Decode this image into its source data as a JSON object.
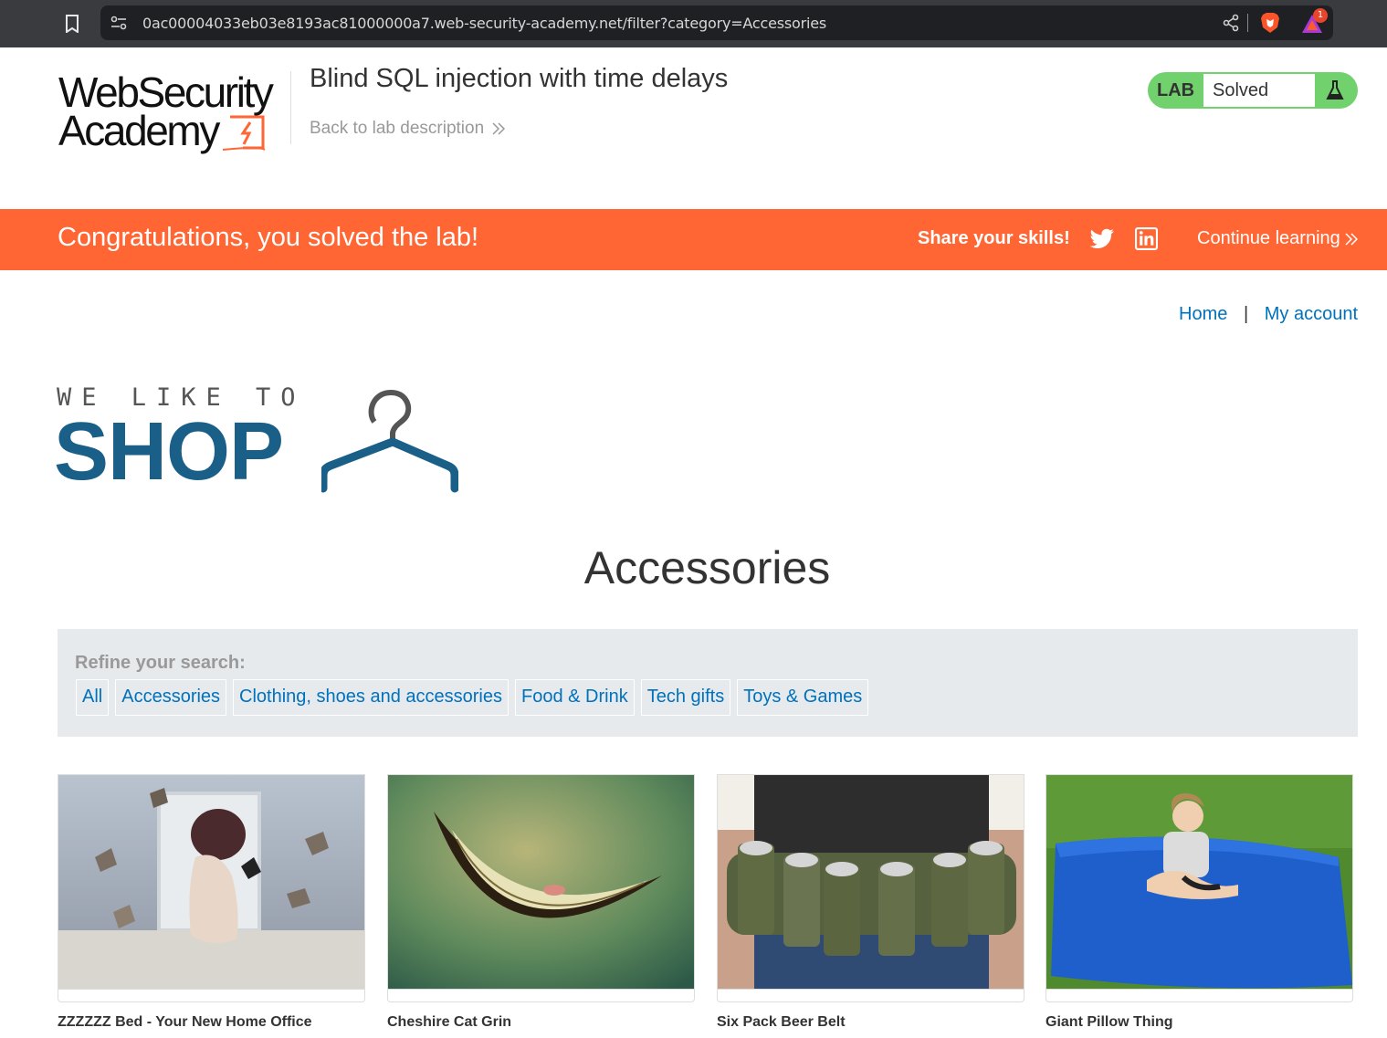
{
  "browser": {
    "url": "0ac00004033eb03e8193ac81000000a7.web-security-academy.net/filter?category=Accessories",
    "rewards_count": "1"
  },
  "header": {
    "logo_line1": "WebSecurity",
    "logo_line2": "Academy",
    "lab_title": "Blind SQL injection with time delays",
    "back_link": "Back to lab description",
    "lab_tag": "LAB",
    "lab_status": "Solved"
  },
  "banner": {
    "message": "Congratulations, you solved the lab!",
    "share_label": "Share your skills!",
    "continue_label": "Continue learning"
  },
  "nav": {
    "home": "Home",
    "separator": "|",
    "account": "My account"
  },
  "shop_logo": {
    "tagline": "WE LIKE TO",
    "name": "SHOP"
  },
  "page": {
    "heading": "Accessories"
  },
  "filter": {
    "label": "Refine your search:",
    "categories": [
      "All",
      "Accessories",
      "Clothing, shoes and accessories",
      "Food & Drink",
      "Tech gifts",
      "Toys & Games"
    ]
  },
  "products": [
    {
      "name": "ZZZZZZ Bed - Your New Home Office"
    },
    {
      "name": "Cheshire Cat Grin"
    },
    {
      "name": "Six Pack Beer Belt"
    },
    {
      "name": "Giant Pillow Thing"
    }
  ],
  "colors": {
    "banner": "#ff6633",
    "link": "#0071bc",
    "lab_status": "#70d16d",
    "shop_blue": "#1a5f87"
  }
}
